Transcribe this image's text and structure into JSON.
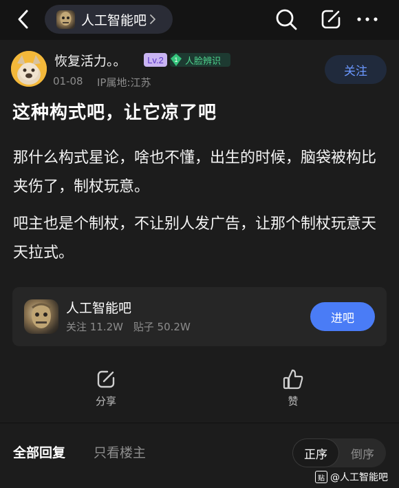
{
  "header": {
    "forum_chip_label": "人工智能吧"
  },
  "post": {
    "author": "恢复活力。。",
    "level_badge": "Lv.2",
    "face_badge_number": "1",
    "face_badge_label": "人脸辨识",
    "date": "01-08",
    "ip": "IP属地:江苏",
    "follow_label": "关注",
    "title": "这种构式吧，让它凉了吧",
    "paragraphs": [
      "那什么构式星论，啥也不懂，出生的时候，脑袋被构比夹伤了，制杖玩意。",
      "吧主也是个制杖，不让别人发广告，让那个制杖玩意天天拉式。"
    ]
  },
  "forum_card": {
    "name": "人工智能吧",
    "followers": "关注 11.2W",
    "posts": "贴子 50.2W",
    "enter_label": "进吧"
  },
  "actions": {
    "share_label": "分享",
    "like_label": "赞"
  },
  "replies": {
    "tab_all": "全部回复",
    "tab_owner": "只看楼主",
    "sort_asc": "正序",
    "sort_desc": "倒序"
  },
  "watermark": {
    "icon_text": "贴",
    "text": "@人工智能吧"
  },
  "colors": {
    "accent_blue": "#4a7cf6",
    "follow_text": "#6b98ff",
    "face_badge_green": "#4fd58f",
    "level_badge_bg": "#c9b4f2"
  }
}
